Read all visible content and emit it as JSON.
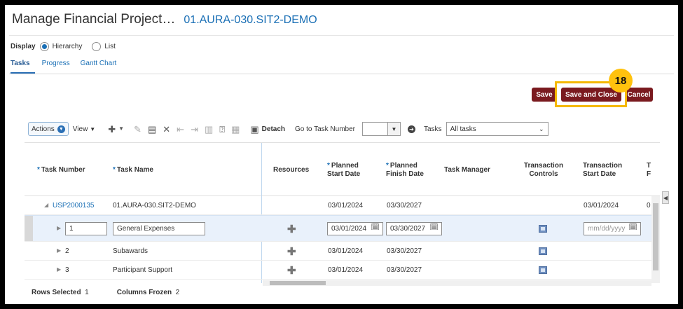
{
  "header": {
    "page_title": "Manage Financial Project…",
    "project_id": "01.AURA-030.SIT2-DEMO"
  },
  "display": {
    "label": "Display",
    "options": [
      {
        "label": "Hierarchy",
        "selected": true
      },
      {
        "label": "List",
        "selected": false
      }
    ]
  },
  "tabs": [
    {
      "label": "Tasks",
      "active": true
    },
    {
      "label": "Progress",
      "active": false
    },
    {
      "label": "Gantt Chart",
      "active": false
    }
  ],
  "buttons": {
    "save": "Save",
    "save_and_close": "Save and Close",
    "cancel": "Cancel"
  },
  "callout": {
    "step": "18",
    "color": "#ffc20e"
  },
  "toolbar": {
    "actions": "Actions",
    "view": "View",
    "detach": "Detach",
    "goto_label": "Go to Task Number",
    "tasks_label": "Tasks",
    "tasks_filter": "All tasks"
  },
  "table": {
    "columns": {
      "task_number": "Task Number",
      "task_name": "Task Name",
      "resources": "Resources",
      "planned_start": "Planned Start Date",
      "planned_finish": "Planned Finish Date",
      "task_manager": "Task Manager",
      "transaction_controls": "Transaction Controls",
      "transaction_start": "Transaction Start Date",
      "truncated": "T F"
    },
    "rows": [
      {
        "number": "USP2000135",
        "name": "01.AURA-030.SIT2-DEMO",
        "start": "03/01/2024",
        "finish": "03/30/2027",
        "tx_start": "03/01/2024",
        "truncated": "0"
      },
      {
        "number": "1",
        "name": "General Expenses",
        "start": "03/01/2024",
        "finish": "03/30/2027",
        "tx_start_placeholder": "mm/dd/yyyy"
      },
      {
        "number": "2",
        "name": "Subawards",
        "start": "03/01/2024",
        "finish": "03/30/2027"
      },
      {
        "number": "3",
        "name": "Participant Support",
        "start": "03/01/2024",
        "finish": "03/30/2027"
      }
    ]
  },
  "footer": {
    "rows_selected_label": "Rows Selected",
    "rows_selected_value": "1",
    "columns_frozen_label": "Columns Frozen",
    "columns_frozen_value": "2"
  },
  "colors": {
    "accent": "#1a6fb5",
    "button": "#7a1a1f",
    "highlight": "#f5b800"
  }
}
